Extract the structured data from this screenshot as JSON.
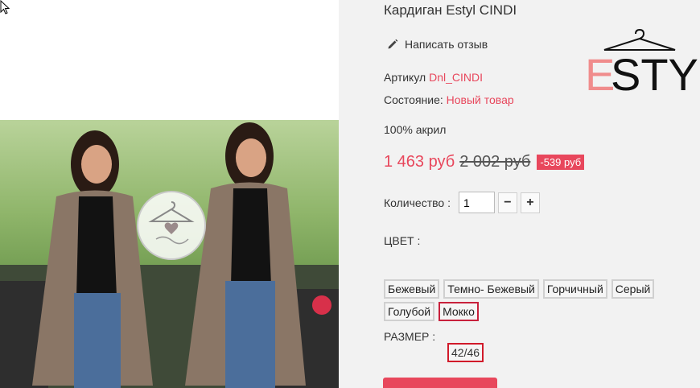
{
  "product": {
    "title": "Кардиган Estyl CINDI",
    "review_link": "Написать отзыв",
    "sku_label": "Артикул",
    "sku_value": "Dnl_CINDI",
    "condition_label": "Состояние:",
    "condition_value": "Новый товар",
    "composition": "100% акрил",
    "price": "1 463 руб",
    "old_price": "2 002 руб",
    "discount": "-539 руб",
    "quantity_label": "Количество :",
    "quantity_value": "1",
    "minus_label": "−",
    "plus_label": "+",
    "color_label": "ЦВЕТ :",
    "colors": [
      "Бежевый",
      "Темно- Бежевый",
      "Горчичный",
      "Серый",
      "Голубой",
      "Мокко"
    ],
    "selected_color": "Мокко",
    "size_label": "РАЗМЕР :",
    "size_value": "42/46"
  },
  "brand": {
    "logo_text": "ESTYL",
    "accent": "#f08c8c"
  },
  "colors": {
    "accent": "#e8475c",
    "selected_border": "#c8213c"
  }
}
